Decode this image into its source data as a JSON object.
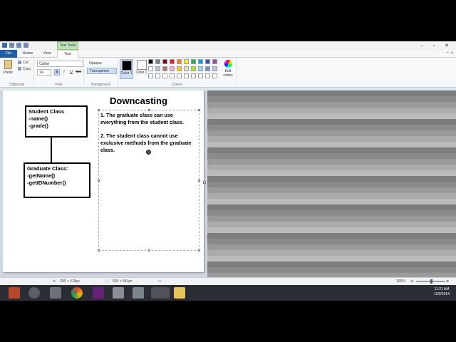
{
  "title_bar": {
    "contextual_tab": "Text Tools"
  },
  "tabs": [
    {
      "label": "File"
    },
    {
      "label": "Home"
    },
    {
      "label": "View"
    },
    {
      "label": "Text"
    }
  ],
  "ribbon": {
    "clipboard": {
      "paste": "Paste",
      "cut": "Cut",
      "copy": "Copy",
      "group": "Clipboard"
    },
    "font": {
      "family": "Calibri",
      "size": "14",
      "bold": "B",
      "italic": "I",
      "underline": "U",
      "strike": "abc",
      "group": "Font"
    },
    "background": {
      "opaque": "Opaque",
      "transparent": "Transparent",
      "group": "Background"
    },
    "colors": {
      "color1": "Color 1",
      "color2": "Color 2",
      "edit": "Edit colors",
      "group": "Colors",
      "color1_value": "#000000",
      "color2_value": "#ffffff",
      "palette": [
        "#000000",
        "#7f7f7f",
        "#880015",
        "#ed1c24",
        "#ff7f27",
        "#fff200",
        "#22b14c",
        "#00a2e8",
        "#3f48cc",
        "#a349a4",
        "#ffffff",
        "#c3c3c3",
        "#b97a57",
        "#ffaec9",
        "#ffc90e",
        "#efe4b0",
        "#b5e61d",
        "#99d9ea",
        "#7092be",
        "#c8bfe7",
        "#ffffff",
        "#ffffff",
        "#ffffff",
        "#ffffff",
        "#ffffff",
        "#ffffff",
        "#ffffff",
        "#ffffff",
        "#ffffff",
        "#ffffff"
      ]
    }
  },
  "canvas": {
    "title": "Downcasting",
    "student_class": {
      "name": "Student Class",
      "methods": [
        "-name()",
        "-grade()"
      ]
    },
    "graduate_class": {
      "name": "Graduate Class:",
      "methods": [
        "-getName()",
        "-getIDNumber()"
      ]
    },
    "notes": [
      "1. The graduate class can use everything from the student class.",
      "2. The student class cannot use exclusive methods from the graduate class."
    ]
  },
  "status_bar": {
    "cursor_pos": "296 × 415px",
    "selection_size": "605 × 541px",
    "zoom": "100%"
  },
  "taskbar": {
    "time": "11:21 AM",
    "date": "11/9/2014"
  }
}
